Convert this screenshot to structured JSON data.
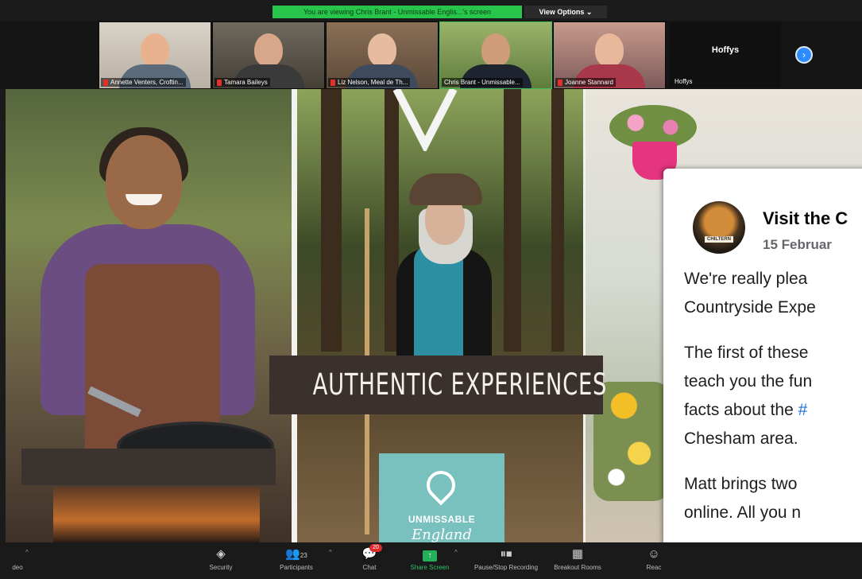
{
  "share_banner": {
    "text": "You are viewing Chris Brant - Unmissable Englis...'s screen",
    "view_options": "View Options ⌄"
  },
  "participants": [
    {
      "name": "Annette Venters, Croftin..."
    },
    {
      "name": "Tamara Baileys"
    },
    {
      "name": "Liz Nelson, Meal de Th..."
    },
    {
      "name": "Chris Brant - Unmissable..."
    },
    {
      "name": "Joanne Stannard"
    },
    {
      "name": "Hoffys"
    }
  ],
  "hoffys_tile": {
    "title": "Hoffys"
  },
  "shared_content": {
    "banner": "AUTHENTIC EXPERIENCES",
    "logo_line1": "UNMISSABLE",
    "logo_line2": "England"
  },
  "facebook_post": {
    "page_name": "Visit the C",
    "date": "15 Februar",
    "avatar_badge": "CHILTERN",
    "lines": [
      "We're really plea",
      "Countryside Expe",
      "The first of these",
      "teach you the fun",
      "Chesham area.",
      "Matt brings two",
      "online.  All you n"
    ],
    "line_facts_prefix": "facts about the ",
    "line_facts_hashtag": "#"
  },
  "toolbar": {
    "video": "deo",
    "security": "Security",
    "participants": "Participants",
    "participant_count": "23",
    "chat": "Chat",
    "chat_badge": "20",
    "share_screen": "Share Screen",
    "pause_recording": "Pause/Stop Recording",
    "breakout_rooms": "Breakout Rooms",
    "reactions": "Reac"
  },
  "icons": {
    "security": "shield-icon",
    "participants": "people-icon",
    "chat": "chat-icon",
    "share": "share-screen-icon",
    "recording": "pause-stop-icon",
    "breakout": "grid-icon",
    "next": "chevron-right-icon"
  },
  "colors": {
    "banner_green": "#27c64a",
    "zoom_blue": "#2d8cff",
    "toolbar_bg": "#1a1a1a",
    "share_green": "#24b05a",
    "fb_link": "#216fdb"
  }
}
